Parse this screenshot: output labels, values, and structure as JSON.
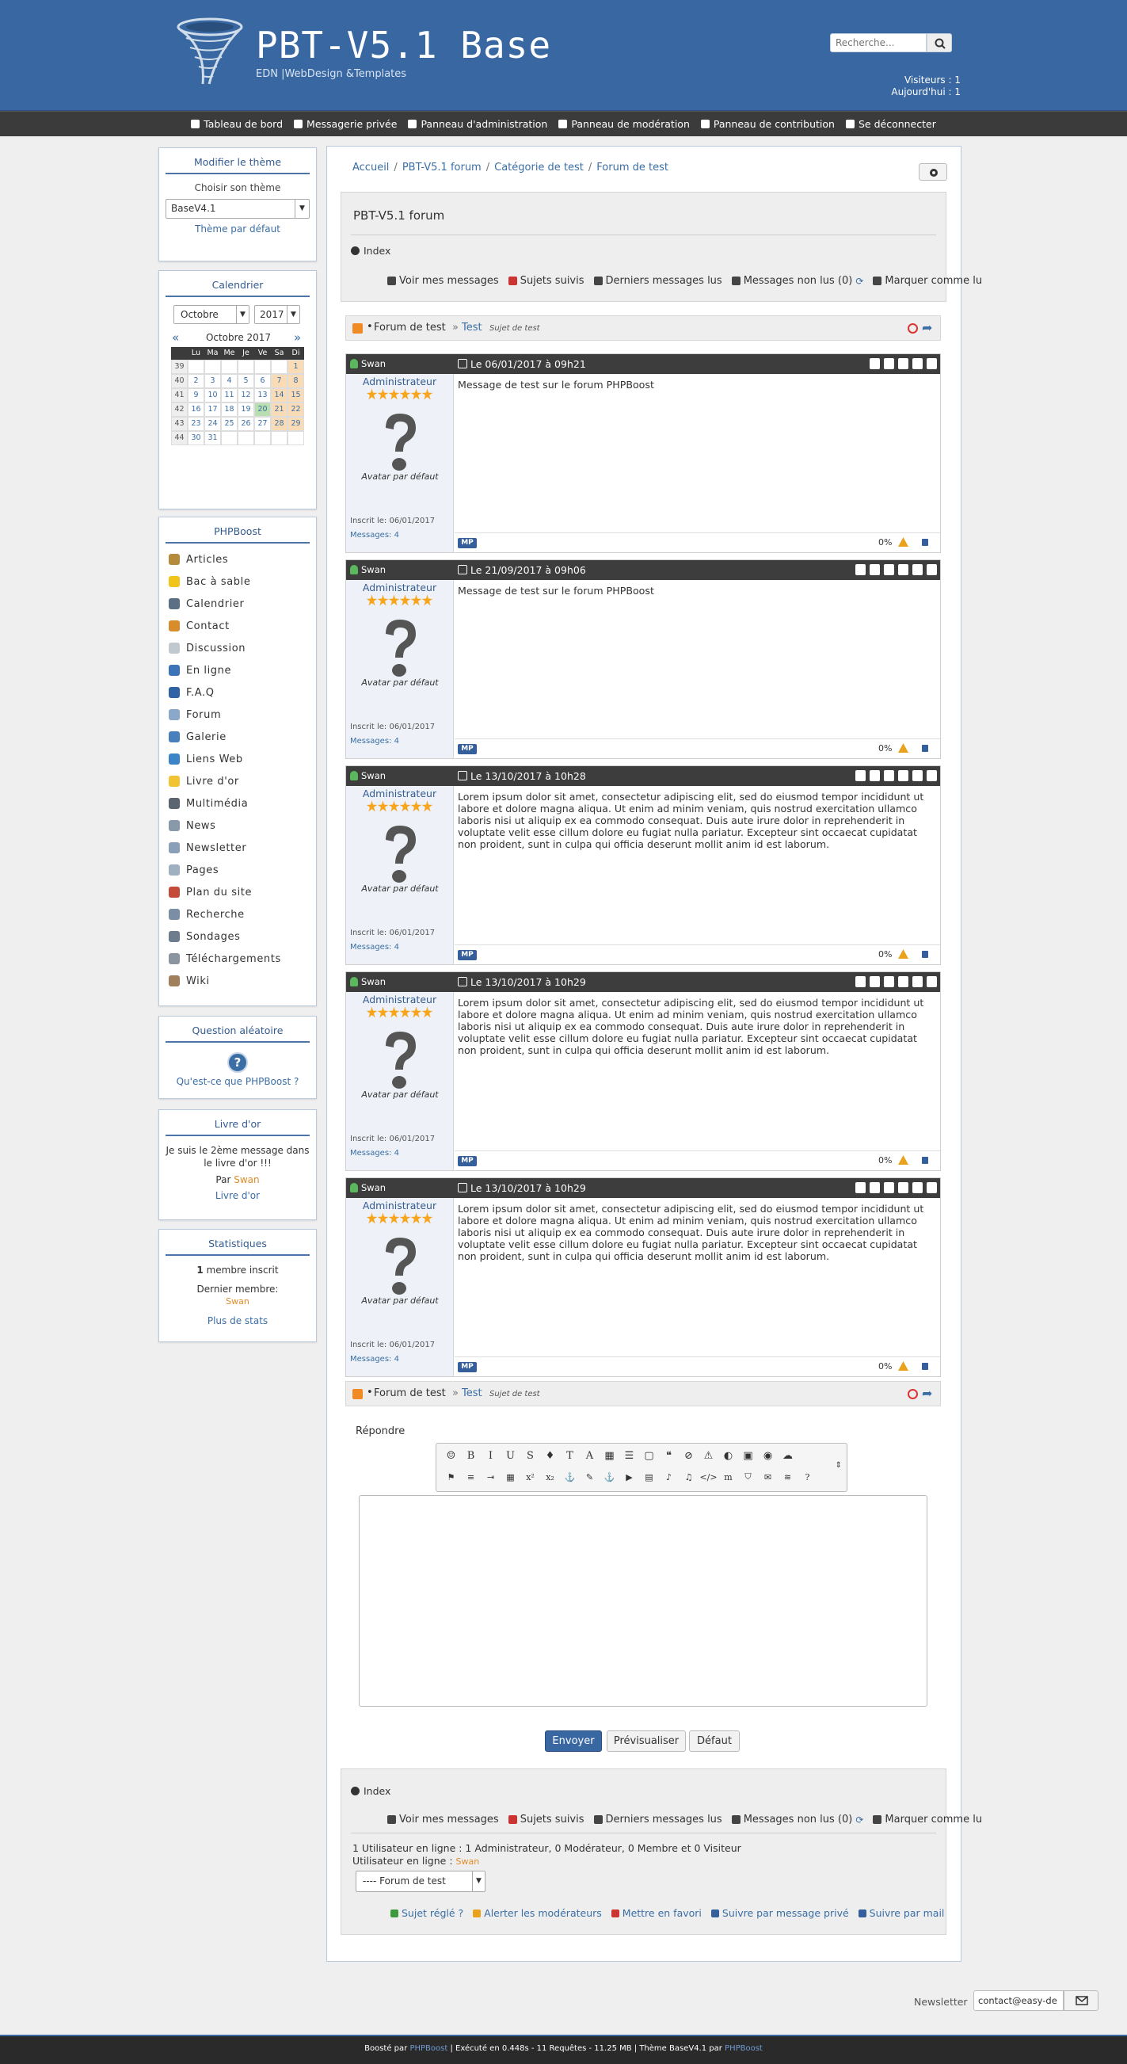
{
  "header": {
    "title": "PBT-V5.1 Base",
    "subtitle": "EDN  |WebDesign &Templates",
    "search_placeholder": "Recherche...",
    "visitors": "Visiteurs : 1",
    "today": "Aujourd'hui : 1"
  },
  "topnav": [
    {
      "label": "Tableau de bord",
      "icon": "dashboard-icon"
    },
    {
      "label": "Messagerie privée",
      "icon": "envelope-icon"
    },
    {
      "label": "Panneau d'administration",
      "icon": "wrench-icon"
    },
    {
      "label": "Panneau de modération",
      "icon": "gavel-icon"
    },
    {
      "label": "Panneau de contribution",
      "icon": "file-icon"
    },
    {
      "label": "Se déconnecter",
      "icon": "sign-out-icon"
    }
  ],
  "theme": {
    "title": "Modifier le thème",
    "choose": "Choisir son thème",
    "selected": "BaseV4.1",
    "default_link": "Thème par défaut"
  },
  "calendar": {
    "title": "Calendrier",
    "month": "Octobre",
    "year": "2017",
    "month_year": "Octobre 2017",
    "days": [
      "Lu",
      "Ma",
      "Me",
      "Je",
      "Ve",
      "Sa",
      "Di"
    ],
    "weeks": [
      {
        "wk": "39",
        "d": [
          "",
          "",
          "",
          "",
          "",
          "",
          "1"
        ]
      },
      {
        "wk": "40",
        "d": [
          "2",
          "3",
          "4",
          "5",
          "6",
          "7",
          "8"
        ]
      },
      {
        "wk": "41",
        "d": [
          "9",
          "10",
          "11",
          "12",
          "13",
          "14",
          "15"
        ]
      },
      {
        "wk": "42",
        "d": [
          "16",
          "17",
          "18",
          "19",
          "20",
          "21",
          "22"
        ]
      },
      {
        "wk": "43",
        "d": [
          "23",
          "24",
          "25",
          "26",
          "27",
          "28",
          "29"
        ]
      },
      {
        "wk": "44",
        "d": [
          "30",
          "31",
          "",
          "",
          "",
          "",
          ""
        ]
      }
    ],
    "today": "20"
  },
  "phpboost": {
    "title": "PHPBoost",
    "items": [
      {
        "label": "Articles",
        "color": "#b58a3a"
      },
      {
        "label": "Bac à sable",
        "color": "#f0c419"
      },
      {
        "label": "Calendrier",
        "color": "#5c6f84"
      },
      {
        "label": "Contact",
        "color": "#d98c2c"
      },
      {
        "label": "Discussion",
        "color": "#c0c8d0"
      },
      {
        "label": "En ligne",
        "color": "#3d73b8"
      },
      {
        "label": "F.A.Q",
        "color": "#2f63a6"
      },
      {
        "label": "Forum",
        "color": "#8aa8c9"
      },
      {
        "label": "Galerie",
        "color": "#4a7fbd"
      },
      {
        "label": "Liens Web",
        "color": "#3b84c7"
      },
      {
        "label": "Livre d'or",
        "color": "#f1c232"
      },
      {
        "label": "Multimédia",
        "color": "#5a6570"
      },
      {
        "label": "News",
        "color": "#8899aa"
      },
      {
        "label": "Newsletter",
        "color": "#8aa0b8"
      },
      {
        "label": "Pages",
        "color": "#9fb0c0"
      },
      {
        "label": "Plan du site",
        "color": "#c44b3a"
      },
      {
        "label": "Recherche",
        "color": "#7a8fa6"
      },
      {
        "label": "Sondages",
        "color": "#6d7d8d"
      },
      {
        "label": "Téléchargements",
        "color": "#8a95a0"
      },
      {
        "label": "Wiki",
        "color": "#a0805a"
      }
    ]
  },
  "question": {
    "title": "Question aléatoire",
    "link": "Qu'est-ce que PHPBoost ?"
  },
  "guestbook": {
    "title": "Livre d'or",
    "text": "Je suis le 2ème message dans le livre d'or !!!",
    "by_label": "Par",
    "by_user": "Swan",
    "link": "Livre d'or"
  },
  "stats": {
    "title": "Statistiques",
    "members_count": "1",
    "members_label": "membre inscrit",
    "last_member_label": "Dernier membre:",
    "last_member": "Swan",
    "more": "Plus de stats"
  },
  "breadcrumb": [
    "Accueil",
    "/",
    "PBT-V5.1 forum",
    "/",
    "Catégorie de test",
    "/",
    "Forum de test"
  ],
  "forum": {
    "title": "PBT-V5.1 forum",
    "index": "Index",
    "actions": [
      "Voir mes messages",
      "Sujets suivis",
      "Derniers messages lus",
      "Messages non lus (0)",
      "Marquer comme lu"
    ]
  },
  "thread": {
    "forum": "Forum de test",
    "sep": "»",
    "topic": "Test",
    "desc": "Sujet de test"
  },
  "posts": [
    {
      "author": "Swan",
      "date": "Le 06/01/2017 à 09h21",
      "role": "Administrateur",
      "avatar": "Avatar par défaut",
      "joined": "Inscrit le: 06/01/2017",
      "msgs": "Messages: 4",
      "text": "Message de test sur le forum PHPBoost",
      "pct": "0%",
      "mp": "MP"
    },
    {
      "author": "Swan",
      "date": "Le 21/09/2017 à 09h06",
      "role": "Administrateur",
      "avatar": "Avatar par défaut",
      "joined": "Inscrit le: 06/01/2017",
      "msgs": "Messages: 4",
      "text": "Message de test sur le forum PHPBoost",
      "pct": "0%",
      "mp": "MP"
    },
    {
      "author": "Swan",
      "date": "Le 13/10/2017 à 10h28",
      "role": "Administrateur",
      "avatar": "Avatar par défaut",
      "joined": "Inscrit le: 06/01/2017",
      "msgs": "Messages: 4",
      "text": "Lorem ipsum dolor sit amet, consectetur adipiscing elit, sed do eiusmod tempor incididunt ut labore et dolore magna aliqua. Ut enim ad minim veniam, quis nostrud exercitation ullamco laboris nisi ut aliquip ex ea commodo consequat. Duis aute irure dolor in reprehenderit in voluptate velit esse cillum dolore eu fugiat nulla pariatur. Excepteur sint occaecat cupidatat non proident, sunt in culpa qui officia deserunt mollit anim id est laborum.",
      "pct": "0%",
      "mp": "MP"
    },
    {
      "author": "Swan",
      "date": "Le 13/10/2017 à 10h29",
      "role": "Administrateur",
      "avatar": "Avatar par défaut",
      "joined": "Inscrit le: 06/01/2017",
      "msgs": "Messages: 4",
      "text": "Lorem ipsum dolor sit amet, consectetur adipiscing elit, sed do eiusmod tempor incididunt ut labore et dolore magna aliqua. Ut enim ad minim veniam, quis nostrud exercitation ullamco laboris nisi ut aliquip ex ea commodo consequat. Duis aute irure dolor in reprehenderit in voluptate velit esse cillum dolore eu fugiat nulla pariatur. Excepteur sint occaecat cupidatat non proident, sunt in culpa qui officia deserunt mollit anim id est laborum.",
      "pct": "0%",
      "mp": "MP"
    },
    {
      "author": "Swan",
      "date": "Le 13/10/2017 à 10h29",
      "role": "Administrateur",
      "avatar": "Avatar par défaut",
      "joined": "Inscrit le: 06/01/2017",
      "msgs": "Messages: 4",
      "text": "Lorem ipsum dolor sit amet, consectetur adipiscing elit, sed do eiusmod tempor incididunt ut labore et dolore magna aliqua. Ut enim ad minim veniam, quis nostrud exercitation ullamco laboris nisi ut aliquip ex ea commodo consequat. Duis aute irure dolor in reprehenderit in voluptate velit esse cillum dolore eu fugiat nulla pariatur. Excepteur sint occaecat cupidatat non proident, sunt in culpa qui officia deserunt mollit anim id est laborum.",
      "pct": "0%",
      "mp": "MP"
    }
  ],
  "reply": {
    "label": "Répondre",
    "send": "Envoyer",
    "preview": "Prévisualiser",
    "reset": "Défaut"
  },
  "bottom": {
    "online": "1 Utilisateur en ligne : 1 Administrateur, 0 Modérateur, 0 Membre et 0 Visiteur",
    "online_label": "Utilisateur en ligne :",
    "online_user": "Swan",
    "select": "---- Forum de test",
    "actions": [
      "Sujet réglé ?",
      "Alerter les modérateurs",
      "Mettre en favori",
      "Suivre par message privé",
      "Suivre par mail"
    ]
  },
  "newsletter": {
    "label": "Newsletter",
    "value": "contact@easy-de"
  },
  "footer": {
    "text1": "Boosté par",
    "link1": "PHPBoost",
    "text2": "| Exécuté en 0.448s - 11 Requêtes - 11.25 MB | Thème BaseV4.1 par",
    "link2": "PHPBoost"
  }
}
